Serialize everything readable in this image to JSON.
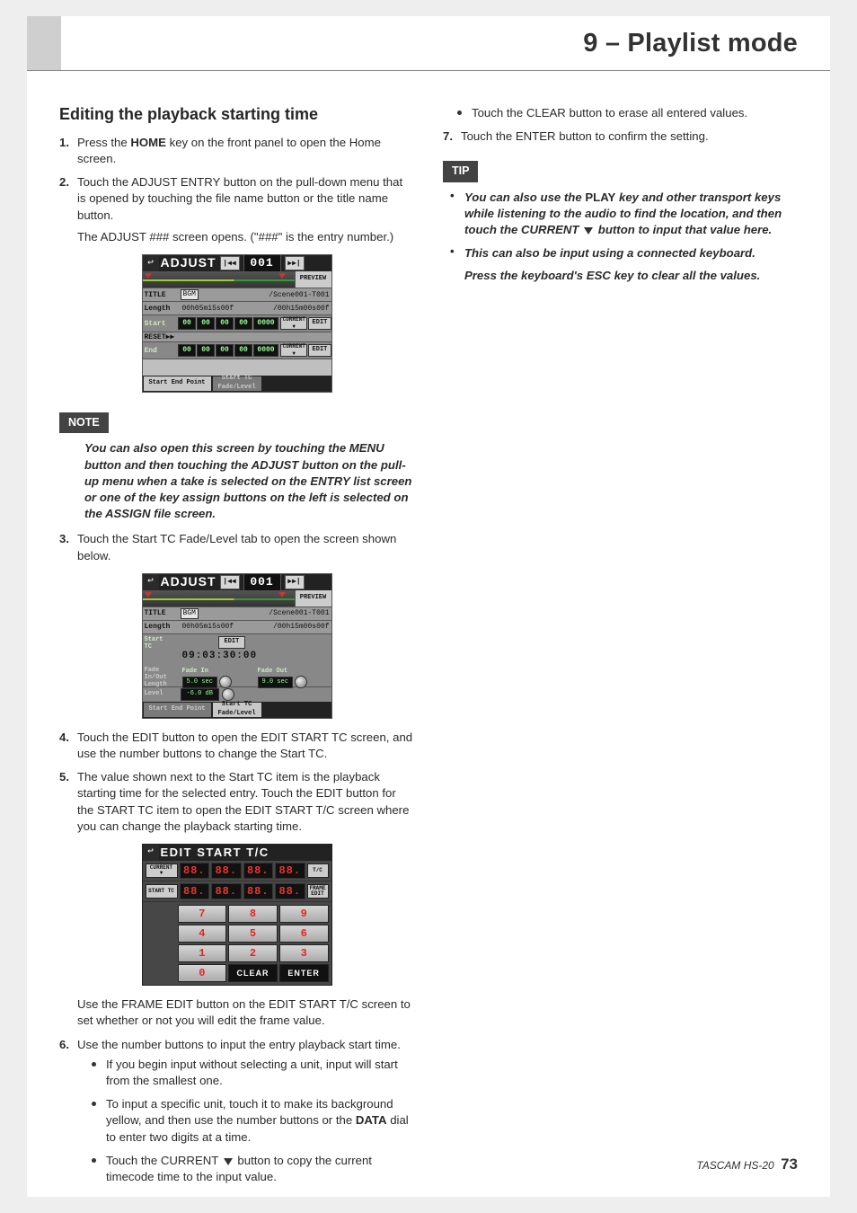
{
  "header": {
    "title": "9 – Playlist mode"
  },
  "section": {
    "title": "Editing the playback starting time"
  },
  "steps": {
    "s1": {
      "num": "1",
      "text_a": "Press the ",
      "home": "HOME",
      "text_b": " key on the front panel to open the Home screen."
    },
    "s2": {
      "num": "2",
      "p1": "Touch the ADJUST ENTRY button on the pull-down menu that is opened by touching the file name button or the title name button.",
      "p2": "The ADJUST ### screen opens. (\"###\" is the entry number.)"
    },
    "s3": {
      "num": "3",
      "text": "Touch the Start TC Fade/Level tab to open the screen shown below."
    },
    "s4": {
      "num": "4",
      "text": "Touch the EDIT button to open the EDIT START TC screen, and use the number buttons to change the Start TC."
    },
    "s5": {
      "num": "5",
      "text": "The value shown next to the Start TC item is the playback starting time for the selected entry. Touch the EDIT button for the START TC item to open the EDIT START T/C screen where you can change the playback starting time."
    },
    "s5_after": "Use the FRAME EDIT button on the EDIT START T/C screen to set whether or not you will edit the frame value.",
    "s6": {
      "num": "6",
      "text": "Use the number buttons to input the entry playback start time."
    },
    "s6_bullets": {
      "b1": "If you begin input without selecting a unit, input will start from the smallest one.",
      "b2_a": "To input a specific unit, touch it to make its background yellow, and then use the number buttons or the ",
      "b2_data": "DATA",
      "b2_b": " dial to enter two digits at a time.",
      "b3_a": "Touch the CURRENT ",
      "b3_b": " button to copy the current timecode time to the input value."
    },
    "s7_bullet": "Touch the CLEAR button to erase all entered values.",
    "s7": {
      "num": "7",
      "text": "Touch the ENTER button to confirm the setting."
    }
  },
  "note": {
    "label": "NOTE",
    "body": "You can also open this screen by touching the MENU button and then touching the ADJUST button on the pull-up menu when a take is selected on the ENTRY list screen or one of the key assign buttons on the left is selected on the ASSIGN file screen."
  },
  "tip": {
    "label": "TIP",
    "t1_a": "You can also use the ",
    "t1_play": "PLAY",
    "t1_b": " key and other transport keys while listening to the audio to find the location, and then touch the CURRENT ",
    "t1_c": " button to input that value here.",
    "t2a": "This can also be input using a connected keyboard.",
    "t2b": "Press the keyboard's ESC key to clear all the values."
  },
  "adjust": {
    "title": "ADJUST",
    "entry": "001",
    "preview": "PREVIEW",
    "title_lab": "TITLE",
    "title_val": "BGM",
    "path": "/Scene001-T001",
    "length_lab": "Length",
    "length_val": "00h05m15s00f",
    "total": "/00h15m00s00f",
    "start_lab": "Start",
    "end_lab": "End",
    "reset": "RESET▶▶",
    "d": "00",
    "f": "0000",
    "current": "CURRENT",
    "edit": "EDIT",
    "tab1": "Start End Point",
    "tab2_a": "Start TC",
    "tab2_b": "Fade/Level"
  },
  "adjust2": {
    "starttc_lab": "Start\nTC",
    "starttc": "09:03:30:00",
    "fade_lab": "Fade\nIn/Out\nLength",
    "fadein_lab": "Fade In",
    "fadein": "5.0 sec",
    "fadeout_lab": "Fade Out",
    "fadeout": "9.0 sec",
    "level_lab": "Level",
    "level": "-6.0 dB"
  },
  "editor": {
    "title": "EDIT START T/C",
    "current": "CURRENT",
    "starttc": "START TC",
    "tc_side": "T/C",
    "frame_a": "FRAME",
    "frame_b": "EDIT",
    "seg": "88.",
    "keys": [
      "7",
      "8",
      "9",
      "4",
      "5",
      "6",
      "1",
      "2",
      "3",
      "0",
      "CLEAR",
      "ENTER"
    ]
  },
  "footer": {
    "model": "TASCAM HS-20",
    "page": "73"
  }
}
